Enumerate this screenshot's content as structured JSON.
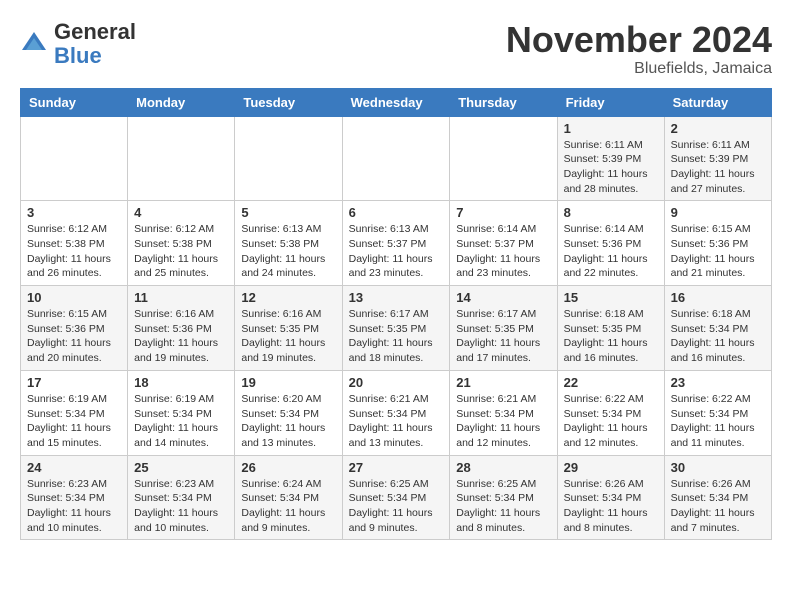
{
  "logo": {
    "general": "General",
    "blue": "Blue"
  },
  "header": {
    "month": "November 2024",
    "location": "Bluefields, Jamaica"
  },
  "weekdays": [
    "Sunday",
    "Monday",
    "Tuesday",
    "Wednesday",
    "Thursday",
    "Friday",
    "Saturday"
  ],
  "weeks": [
    [
      {
        "day": "",
        "info": ""
      },
      {
        "day": "",
        "info": ""
      },
      {
        "day": "",
        "info": ""
      },
      {
        "day": "",
        "info": ""
      },
      {
        "day": "",
        "info": ""
      },
      {
        "day": "1",
        "info": "Sunrise: 6:11 AM\nSunset: 5:39 PM\nDaylight: 11 hours and 28 minutes."
      },
      {
        "day": "2",
        "info": "Sunrise: 6:11 AM\nSunset: 5:39 PM\nDaylight: 11 hours and 27 minutes."
      }
    ],
    [
      {
        "day": "3",
        "info": "Sunrise: 6:12 AM\nSunset: 5:38 PM\nDaylight: 11 hours and 26 minutes."
      },
      {
        "day": "4",
        "info": "Sunrise: 6:12 AM\nSunset: 5:38 PM\nDaylight: 11 hours and 25 minutes."
      },
      {
        "day": "5",
        "info": "Sunrise: 6:13 AM\nSunset: 5:38 PM\nDaylight: 11 hours and 24 minutes."
      },
      {
        "day": "6",
        "info": "Sunrise: 6:13 AM\nSunset: 5:37 PM\nDaylight: 11 hours and 23 minutes."
      },
      {
        "day": "7",
        "info": "Sunrise: 6:14 AM\nSunset: 5:37 PM\nDaylight: 11 hours and 23 minutes."
      },
      {
        "day": "8",
        "info": "Sunrise: 6:14 AM\nSunset: 5:36 PM\nDaylight: 11 hours and 22 minutes."
      },
      {
        "day": "9",
        "info": "Sunrise: 6:15 AM\nSunset: 5:36 PM\nDaylight: 11 hours and 21 minutes."
      }
    ],
    [
      {
        "day": "10",
        "info": "Sunrise: 6:15 AM\nSunset: 5:36 PM\nDaylight: 11 hours and 20 minutes."
      },
      {
        "day": "11",
        "info": "Sunrise: 6:16 AM\nSunset: 5:36 PM\nDaylight: 11 hours and 19 minutes."
      },
      {
        "day": "12",
        "info": "Sunrise: 6:16 AM\nSunset: 5:35 PM\nDaylight: 11 hours and 19 minutes."
      },
      {
        "day": "13",
        "info": "Sunrise: 6:17 AM\nSunset: 5:35 PM\nDaylight: 11 hours and 18 minutes."
      },
      {
        "day": "14",
        "info": "Sunrise: 6:17 AM\nSunset: 5:35 PM\nDaylight: 11 hours and 17 minutes."
      },
      {
        "day": "15",
        "info": "Sunrise: 6:18 AM\nSunset: 5:35 PM\nDaylight: 11 hours and 16 minutes."
      },
      {
        "day": "16",
        "info": "Sunrise: 6:18 AM\nSunset: 5:34 PM\nDaylight: 11 hours and 16 minutes."
      }
    ],
    [
      {
        "day": "17",
        "info": "Sunrise: 6:19 AM\nSunset: 5:34 PM\nDaylight: 11 hours and 15 minutes."
      },
      {
        "day": "18",
        "info": "Sunrise: 6:19 AM\nSunset: 5:34 PM\nDaylight: 11 hours and 14 minutes."
      },
      {
        "day": "19",
        "info": "Sunrise: 6:20 AM\nSunset: 5:34 PM\nDaylight: 11 hours and 13 minutes."
      },
      {
        "day": "20",
        "info": "Sunrise: 6:21 AM\nSunset: 5:34 PM\nDaylight: 11 hours and 13 minutes."
      },
      {
        "day": "21",
        "info": "Sunrise: 6:21 AM\nSunset: 5:34 PM\nDaylight: 11 hours and 12 minutes."
      },
      {
        "day": "22",
        "info": "Sunrise: 6:22 AM\nSunset: 5:34 PM\nDaylight: 11 hours and 12 minutes."
      },
      {
        "day": "23",
        "info": "Sunrise: 6:22 AM\nSunset: 5:34 PM\nDaylight: 11 hours and 11 minutes."
      }
    ],
    [
      {
        "day": "24",
        "info": "Sunrise: 6:23 AM\nSunset: 5:34 PM\nDaylight: 11 hours and 10 minutes."
      },
      {
        "day": "25",
        "info": "Sunrise: 6:23 AM\nSunset: 5:34 PM\nDaylight: 11 hours and 10 minutes."
      },
      {
        "day": "26",
        "info": "Sunrise: 6:24 AM\nSunset: 5:34 PM\nDaylight: 11 hours and 9 minutes."
      },
      {
        "day": "27",
        "info": "Sunrise: 6:25 AM\nSunset: 5:34 PM\nDaylight: 11 hours and 9 minutes."
      },
      {
        "day": "28",
        "info": "Sunrise: 6:25 AM\nSunset: 5:34 PM\nDaylight: 11 hours and 8 minutes."
      },
      {
        "day": "29",
        "info": "Sunrise: 6:26 AM\nSunset: 5:34 PM\nDaylight: 11 hours and 8 minutes."
      },
      {
        "day": "30",
        "info": "Sunrise: 6:26 AM\nSunset: 5:34 PM\nDaylight: 11 hours and 7 minutes."
      }
    ]
  ]
}
